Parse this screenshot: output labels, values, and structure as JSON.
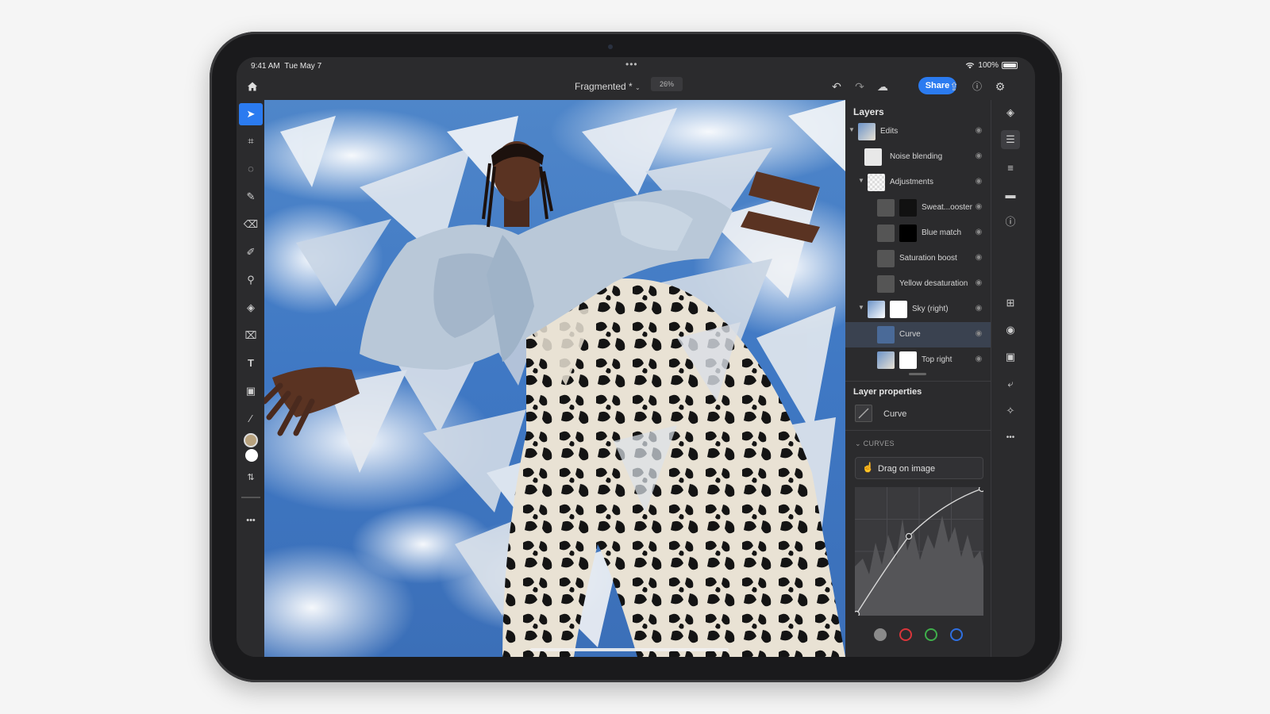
{
  "status_bar": {
    "time": "9:41 AM",
    "date": "Tue May 7",
    "battery": "100%"
  },
  "topbar": {
    "doc_title": "Fragmented *",
    "zoom": "26%",
    "share_label": "Share"
  },
  "layers_panel": {
    "title": "Layers",
    "layers": [
      {
        "label": "Edits"
      },
      {
        "label": "Noise blending"
      },
      {
        "label": "Adjustments"
      },
      {
        "label": "Sweat...ooster"
      },
      {
        "label": "Blue match"
      },
      {
        "label": "Saturation boost"
      },
      {
        "label": "Yellow desaturation"
      },
      {
        "label": "Sky (right)"
      },
      {
        "label": "Curve",
        "selected": true
      },
      {
        "label": "Top right"
      }
    ]
  },
  "layer_properties": {
    "title": "Layer properties",
    "layer_name": "Curve",
    "section": "CURVES",
    "drag_label": "Drag on image",
    "channels": [
      {
        "name": "composite",
        "color": "#8a8a8a"
      },
      {
        "name": "red",
        "color": "#d9353a"
      },
      {
        "name": "green",
        "color": "#3fae4b"
      },
      {
        "name": "blue",
        "color": "#2f6fe0"
      }
    ]
  },
  "colors": {
    "accent": "#2b7bf0",
    "panel_bg": "#2b2b2d",
    "foreground_swatch": "#b8a27e",
    "background_swatch": "#ffffff"
  }
}
